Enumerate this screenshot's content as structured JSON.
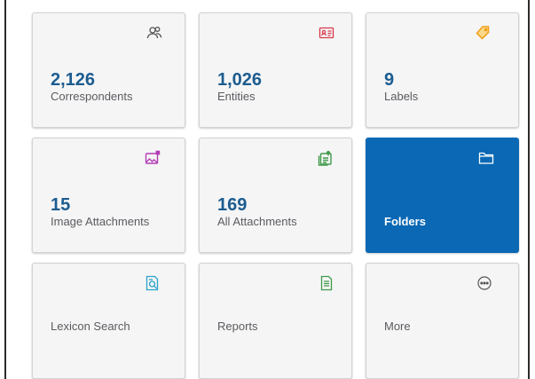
{
  "tiles": [
    {
      "id": "correspondents",
      "count": "2,126",
      "label": "Correspondents",
      "icon": "people-icon",
      "icon_color": "#555555"
    },
    {
      "id": "entities",
      "count": "1,026",
      "label": "Entities",
      "icon": "id-card-icon",
      "icon_color": "#d8394a"
    },
    {
      "id": "labels",
      "count": "9",
      "label": "Labels",
      "icon": "tag-icon",
      "icon_color": "#f0a21e"
    },
    {
      "id": "image-attachments",
      "count": "15",
      "label": "Image Attachments",
      "icon": "image-attachment-icon",
      "icon_color": "#b23bb4"
    },
    {
      "id": "all-attachments",
      "count": "169",
      "label": "All Attachments",
      "icon": "attachments-icon",
      "icon_color": "#3f9a4a"
    },
    {
      "id": "folders",
      "count": "",
      "label": "Folders",
      "icon": "folder-icon",
      "icon_color": "#ffffff",
      "active": true
    },
    {
      "id": "lexicon-search",
      "count": "",
      "label": "Lexicon Search",
      "icon": "document-search-icon",
      "icon_color": "#2ba4c8"
    },
    {
      "id": "reports",
      "count": "",
      "label": "Reports",
      "icon": "report-icon",
      "icon_color": "#3f9a4a"
    },
    {
      "id": "more",
      "count": "",
      "label": "More",
      "icon": "more-icon",
      "icon_color": "#555555"
    }
  ],
  "colors": {
    "accent": "#0a68b4",
    "count_text": "#1c5c8f"
  }
}
